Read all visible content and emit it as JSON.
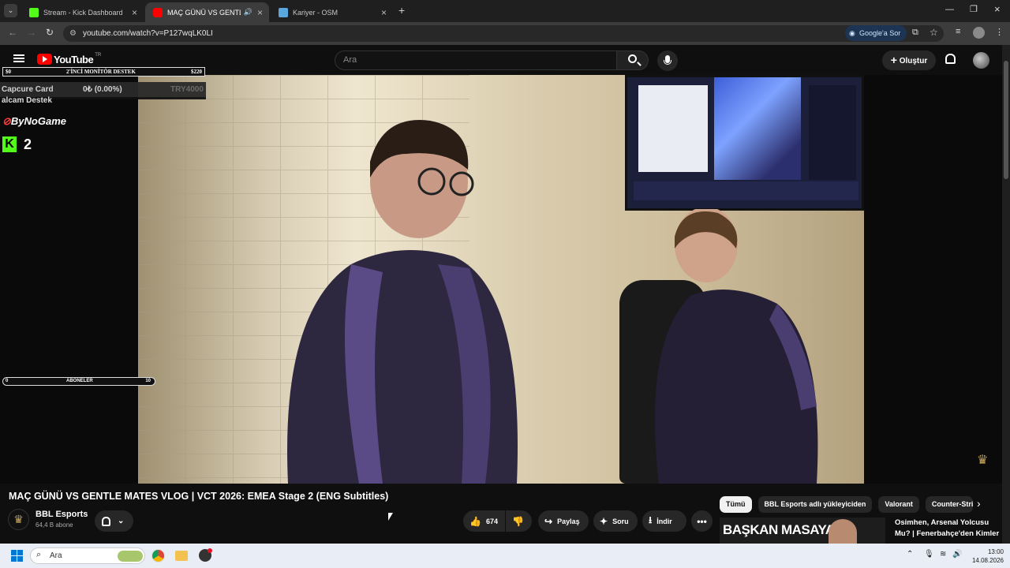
{
  "browser": {
    "tabs": [
      {
        "label": "Stream - Kick Dashboard",
        "active": false
      },
      {
        "label": "MAÇ GÜNÜ VS GENTLE MA",
        "active": true
      },
      {
        "label": "Kariyer - OSM",
        "active": false
      }
    ],
    "url": "youtube.com/watch?v=P127wqLK0LI",
    "google_ask": "Google'a Sor"
  },
  "youtube": {
    "logo": "YouTube",
    "region": "TR",
    "search_placeholder": "Ara",
    "create_label": "Oluştur"
  },
  "stream_overlay": {
    "monitor_goal": {
      "left": "$0",
      "title": "2'İNCİ MONİTÖR DESTEK",
      "right": "$220"
    },
    "capture_card": {
      "label": "Capcure Card",
      "amount": "0₺ (0.00%)",
      "target": "TRY4000"
    },
    "capture_sub": "alcam Destek",
    "brand": "ByNoGame",
    "kick_count": "2",
    "subs_bar": {
      "left": "0",
      "title": "ABONELER",
      "right": "10"
    }
  },
  "video": {
    "title": "MAÇ GÜNÜ VS GENTLE MATES VLOG | VCT 2026: EMEA Stage 2 (ENG Subtitles)",
    "channel": "BBL Esports",
    "subscribers": "64,4 B abone",
    "likes": "674",
    "share": "Paylaş",
    "ask": "Soru",
    "download": "İndir"
  },
  "chips": [
    "Tümü",
    "BBL Esports adlı yükleyiciden",
    "Valorant",
    "Counter-Strik"
  ],
  "recommendation": {
    "thumb_text": "BAŞKAN MASAYA",
    "title_line1": "Osimhen, Arsenal Yolcusu",
    "title_line2": "Mu? | Fenerbahçe'den Kimler"
  },
  "taskbar": {
    "search": "Ara",
    "time": "13:00",
    "date": "14.08.2026"
  },
  "colors": {
    "accent_red": "#ff0000",
    "kick_green": "#53fc18",
    "chip_active": "#f1f1f1"
  }
}
